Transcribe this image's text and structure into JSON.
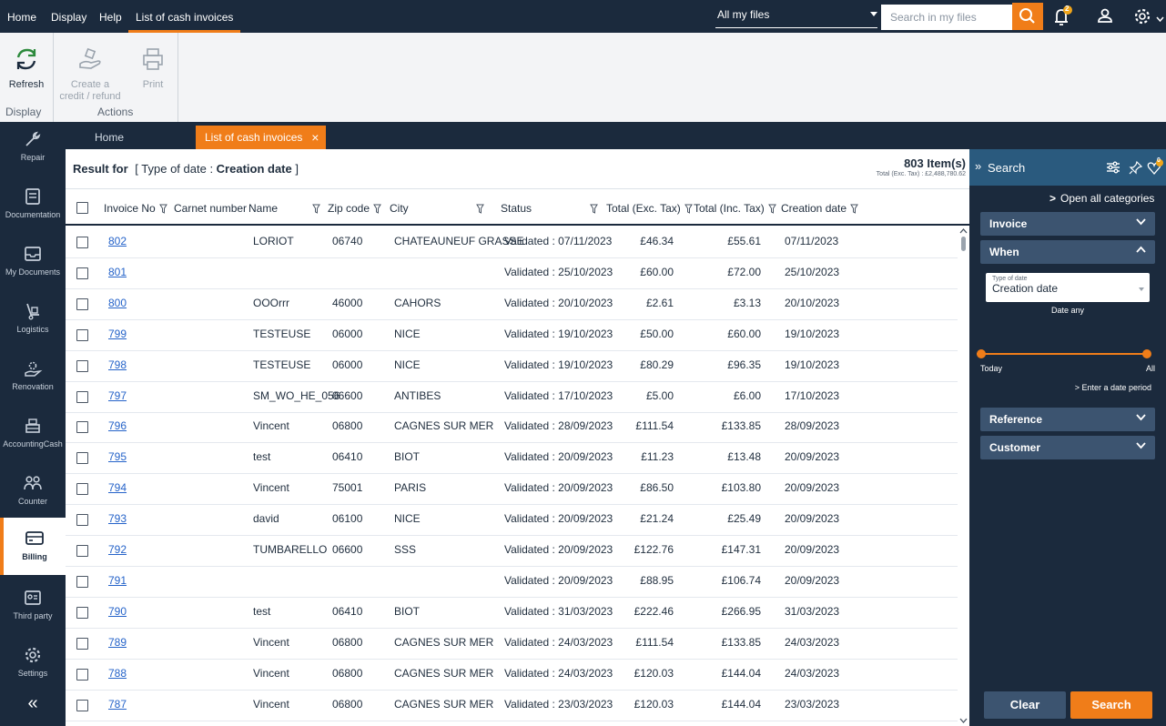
{
  "topbar": {
    "menu": [
      "Home",
      "Display",
      "Help",
      "List of cash invoices"
    ],
    "files_select": "All my files",
    "search_placeholder": "Search in my files",
    "notification_count": "2"
  },
  "ribbon": {
    "refresh": "Refresh",
    "create_credit_line1": "Create a",
    "create_credit_line2": "credit / refund",
    "print": "Print",
    "group_display": "Display",
    "group_actions": "Actions"
  },
  "sidebar": {
    "items": [
      "Repair",
      "Documentation",
      "My Documents",
      "Logistics",
      "Renovation",
      "AccountingCash",
      "Counter",
      "Billing",
      "Third party",
      "Settings"
    ],
    "collapse": "«"
  },
  "tabs": [
    "Home",
    "List of cash invoices"
  ],
  "result": {
    "prefix": "Result for",
    "filter_open": "[ Type of date : ",
    "filter_value": "Creation date",
    "filter_close": " ]",
    "item_count": "803 Item(s)",
    "total_exc": "Total (Exc. Tax) : £2,488,780.62"
  },
  "columns": [
    "Invoice No",
    "Carnet number",
    "Name",
    "Zip code",
    "City",
    "Status",
    "Total (Exc. Tax)",
    "Total (Inc. Tax)",
    "Creation date"
  ],
  "rows": [
    {
      "no": "802",
      "carnet": "",
      "name": "LORIOT",
      "zip": "06740",
      "city": "CHATEAUNEUF GRASSE",
      "status": "Validated : 07/11/2023",
      "exc": "£46.34",
      "inc": "£55.61",
      "date": "07/11/2023"
    },
    {
      "no": "801",
      "carnet": "",
      "name": "",
      "zip": "",
      "city": "",
      "status": "Validated : 25/10/2023",
      "exc": "£60.00",
      "inc": "£72.00",
      "date": "25/10/2023"
    },
    {
      "no": "800",
      "carnet": "",
      "name": "OOOrrr",
      "zip": "46000",
      "city": "CAHORS",
      "status": "Validated : 20/10/2023",
      "exc": "£2.61",
      "inc": "£3.13",
      "date": "20/10/2023"
    },
    {
      "no": "799",
      "carnet": "",
      "name": "TESTEUSE",
      "zip": "06000",
      "city": "NICE",
      "status": "Validated : 19/10/2023",
      "exc": "£50.00",
      "inc": "£60.00",
      "date": "19/10/2023"
    },
    {
      "no": "798",
      "carnet": "",
      "name": "TESTEUSE",
      "zip": "06000",
      "city": "NICE",
      "status": "Validated : 19/10/2023",
      "exc": "£80.29",
      "inc": "£96.35",
      "date": "19/10/2023"
    },
    {
      "no": "797",
      "carnet": "",
      "name": "SM_WO_HE_056",
      "zip": "06600",
      "city": "ANTIBES",
      "status": "Validated : 17/10/2023",
      "exc": "£5.00",
      "inc": "£6.00",
      "date": "17/10/2023"
    },
    {
      "no": "796",
      "carnet": "",
      "name": "Vincent",
      "zip": "06800",
      "city": "CAGNES SUR MER",
      "status": "Validated : 28/09/2023",
      "exc": "£111.54",
      "inc": "£133.85",
      "date": "28/09/2023"
    },
    {
      "no": "795",
      "carnet": "",
      "name": "test",
      "zip": "06410",
      "city": "BIOT",
      "status": "Validated : 20/09/2023",
      "exc": "£11.23",
      "inc": "£13.48",
      "date": "20/09/2023"
    },
    {
      "no": "794",
      "carnet": "",
      "name": "Vincent",
      "zip": "75001",
      "city": "PARIS",
      "status": "Validated : 20/09/2023",
      "exc": "£86.50",
      "inc": "£103.80",
      "date": "20/09/2023"
    },
    {
      "no": "793",
      "carnet": "",
      "name": "david",
      "zip": "06100",
      "city": "NICE",
      "status": "Validated : 20/09/2023",
      "exc": "£21.24",
      "inc": "£25.49",
      "date": "20/09/2023"
    },
    {
      "no": "792",
      "carnet": "",
      "name": "TUMBARELLO",
      "zip": "06600",
      "city": "SSS",
      "status": "Validated : 20/09/2023",
      "exc": "£122.76",
      "inc": "£147.31",
      "date": "20/09/2023"
    },
    {
      "no": "791",
      "carnet": "",
      "name": "",
      "zip": "",
      "city": "",
      "status": "Validated : 20/09/2023",
      "exc": "£88.95",
      "inc": "£106.74",
      "date": "20/09/2023"
    },
    {
      "no": "790",
      "carnet": "",
      "name": "test",
      "zip": "06410",
      "city": "BIOT",
      "status": "Validated : 31/03/2023",
      "exc": "£222.46",
      "inc": "£266.95",
      "date": "31/03/2023"
    },
    {
      "no": "789",
      "carnet": "",
      "name": "Vincent",
      "zip": "06800",
      "city": "CAGNES SUR MER",
      "status": "Validated : 24/03/2023",
      "exc": "£111.54",
      "inc": "£133.85",
      "date": "24/03/2023"
    },
    {
      "no": "788",
      "carnet": "",
      "name": "Vincent",
      "zip": "06800",
      "city": "CAGNES SUR MER",
      "status": "Validated : 24/03/2023",
      "exc": "£120.03",
      "inc": "£144.04",
      "date": "24/03/2023"
    },
    {
      "no": "787",
      "carnet": "",
      "name": "Vincent",
      "zip": "06800",
      "city": "CAGNES SUR MER",
      "status": "Validated : 23/03/2023",
      "exc": "£120.03",
      "inc": "£144.04",
      "date": "23/03/2023"
    }
  ],
  "panel": {
    "title": "Search",
    "favorites_count": "0",
    "open_all": "Open all categories",
    "cat_invoice": "Invoice",
    "cat_when": "When",
    "date_type_label": "Type of date",
    "date_type_value": "Creation date",
    "date_any": "Date any",
    "slider_min": "Today",
    "slider_max": "All",
    "enter_period": "> Enter a date period",
    "cat_reference": "Reference",
    "cat_customer": "Customer",
    "clear": "Clear",
    "search": "Search"
  },
  "colors": {
    "accent": "#f07d19",
    "navy": "#1b2a3d",
    "panel_head": "#2a5a7e",
    "link": "#2563c9"
  }
}
